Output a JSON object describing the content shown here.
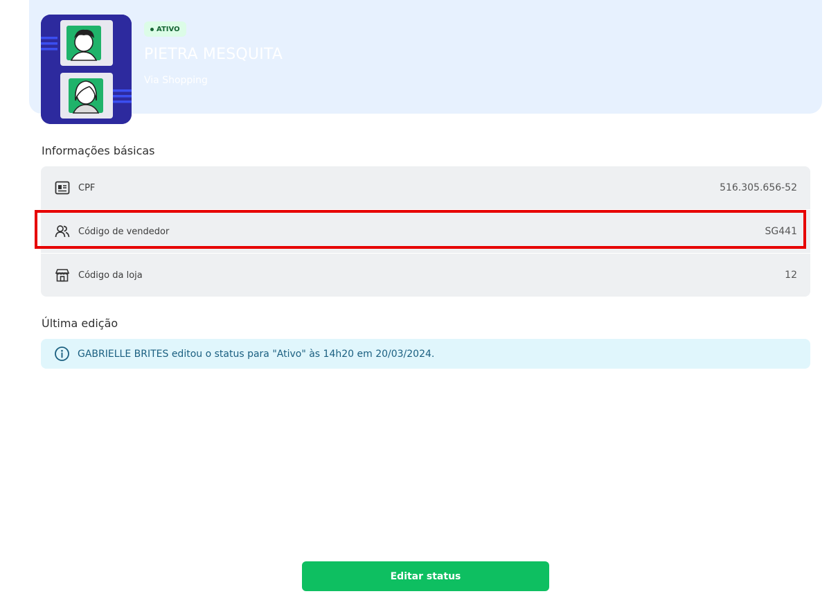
{
  "profile": {
    "status": "ATIVO",
    "name": "PIETRA MESQUITA",
    "store": "Via Shopping"
  },
  "basic_info": {
    "title": "Informações básicas",
    "rows": [
      {
        "label": "CPF",
        "value": "516.305.656-52",
        "icon": "id-card-icon"
      },
      {
        "label": "Código de vendedor",
        "value": "SG441",
        "icon": "users-icon"
      },
      {
        "label": "Código da loja",
        "value": "12",
        "icon": "store-icon"
      }
    ]
  },
  "last_edit": {
    "title": "Última edição",
    "message": "GABRIELLE BRITES editou o status para \"Ativo\" às 14h20 em 20/03/2024.",
    "icon": "info-icon"
  },
  "actions": {
    "edit_status_label": "Editar status"
  },
  "colors": {
    "accent": "#0ebf61",
    "header_bg": "#e7f1fe",
    "avatar_bg": "#2d2a9e",
    "highlight": "#e60000",
    "alert_bg": "#e0f6fc"
  }
}
